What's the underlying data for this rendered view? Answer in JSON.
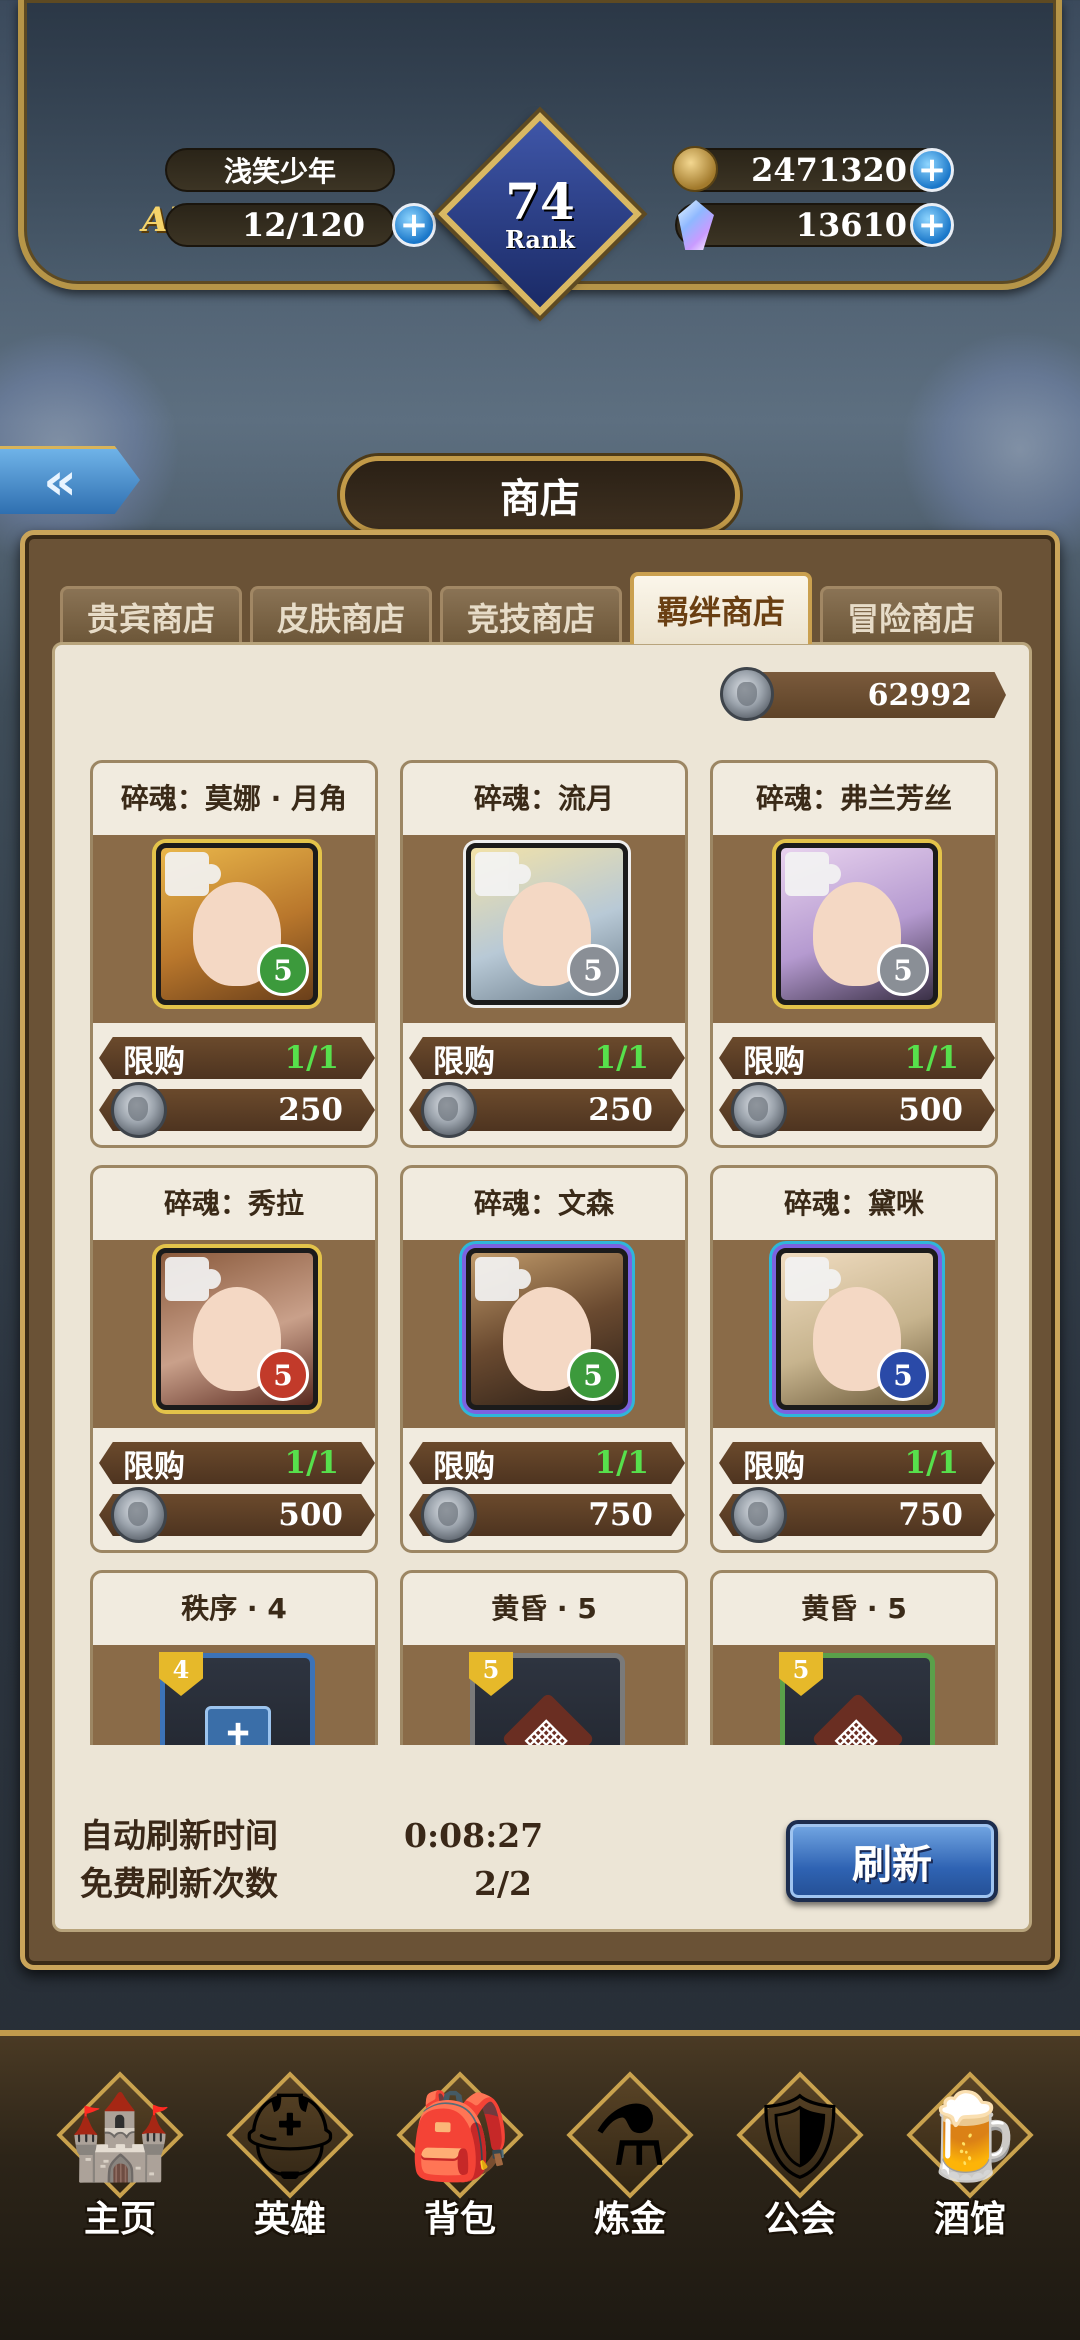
{
  "header": {
    "player_name": "浅笑少年",
    "ap_label": "AP",
    "ap_value": "12/120",
    "rank_value": "74",
    "rank_label": "Rank",
    "gold_value": "2471320",
    "gem_value": "13610",
    "plus_symbol": "+"
  },
  "shop": {
    "back_symbol": "«",
    "title": "商店",
    "tabs": [
      {
        "label": "贵宾商店",
        "active": false
      },
      {
        "label": "皮肤商店",
        "active": false
      },
      {
        "label": "竞技商店",
        "active": false
      },
      {
        "label": "羁绊商店",
        "active": true
      },
      {
        "label": "冒险商店",
        "active": false
      }
    ],
    "bond_currency": "62992",
    "items": [
      {
        "title": "碎魂：莫娜 · 月角",
        "stars": "5",
        "limit_label": "限购",
        "limit": "1/1",
        "price": "250",
        "star_color": "#3c9a3c",
        "frame": "gold"
      },
      {
        "title": "碎魂：流月",
        "stars": "5",
        "limit_label": "限购",
        "limit": "1/1",
        "price": "250",
        "star_color": "#8a8f96",
        "frame": "plain"
      },
      {
        "title": "碎魂：弗兰芳丝",
        "stars": "5",
        "limit_label": "限购",
        "limit": "1/1",
        "price": "500",
        "star_color": "#8a8f96",
        "frame": "gold"
      },
      {
        "title": "碎魂：秀拉",
        "stars": "5",
        "limit_label": "限购",
        "limit": "1/1",
        "price": "500",
        "star_color": "#c23a2a",
        "frame": "gold"
      },
      {
        "title": "碎魂：文森",
        "stars": "5",
        "limit_label": "限购",
        "limit": "1/1",
        "price": "750",
        "star_color": "#3c9a3c",
        "frame": "rainbow"
      },
      {
        "title": "碎魂：黛咪",
        "stars": "5",
        "limit_label": "限购",
        "limit": "1/1",
        "price": "750",
        "star_color": "#2a4aa8",
        "frame": "rainbow"
      },
      {
        "title": "秩序 · 4",
        "rank": "4",
        "icon": "shield-cross-icon",
        "frame_color": "#3c73b8"
      },
      {
        "title": "黄昏 · 5",
        "rank": "5",
        "icon": "castle-icon",
        "frame_color": "#7a7a7a"
      },
      {
        "title": "黄昏 · 5",
        "rank": "5",
        "icon": "castle-icon",
        "frame_color": "#5aa04a"
      }
    ],
    "refresh": {
      "auto_label": "自动刷新时间",
      "auto_value": "0:08:27",
      "free_label": "免费刷新次数",
      "free_value": "2/2",
      "button_label": "刷新"
    }
  },
  "nav": [
    {
      "label": "主页",
      "icon": "castle-home-icon"
    },
    {
      "label": "英雄",
      "icon": "knight-helmet-icon"
    },
    {
      "label": "背包",
      "icon": "backpack-icon"
    },
    {
      "label": "炼金",
      "icon": "potion-flask-icon"
    },
    {
      "label": "公会",
      "icon": "guild-shield-icon"
    },
    {
      "label": "酒馆",
      "icon": "beer-mug-icon"
    }
  ]
}
